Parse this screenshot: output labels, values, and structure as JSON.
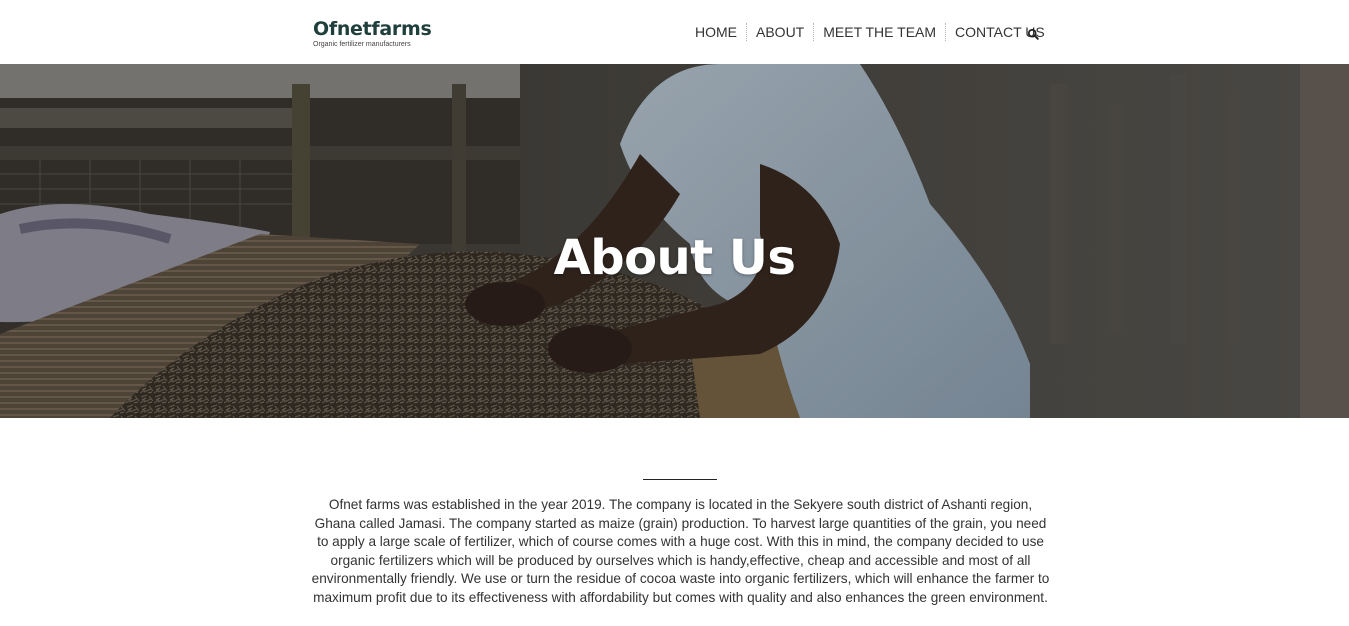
{
  "brand": {
    "name": "Ofnetfarms",
    "tagline": "Organic fertilizer manufacturers",
    "color": "#1f3f3c"
  },
  "nav": {
    "items": [
      {
        "label": "HOME"
      },
      {
        "label": "ABOUT"
      },
      {
        "label": "MEET THE TEAM"
      },
      {
        "label": "CONTACT US"
      }
    ],
    "search_icon": "search-icon"
  },
  "hero": {
    "title": "About Us",
    "image": "man-spreading-cocoa-residue-on-drying-mats"
  },
  "about": {
    "body": "Ofnet farms was established in the year 2019. The company is located in the Sekyere south district of Ashanti region, Ghana called Jamasi. The company started as maize (grain) production. To harvest large quantities of the grain, you need to apply a large scale of fertilizer, which of course comes with a huge cost. With this in mind, the company decided to use organic fertilizers which will be produced by ourselves which is handy,effective, cheap and accessible and most of all environmentally friendly. We use or turn the residue of cocoa waste into organic fertilizers, which will enhance the farmer to maximum profit due to its effectiveness with affordability but comes with quality and also enhances the green environment."
  }
}
